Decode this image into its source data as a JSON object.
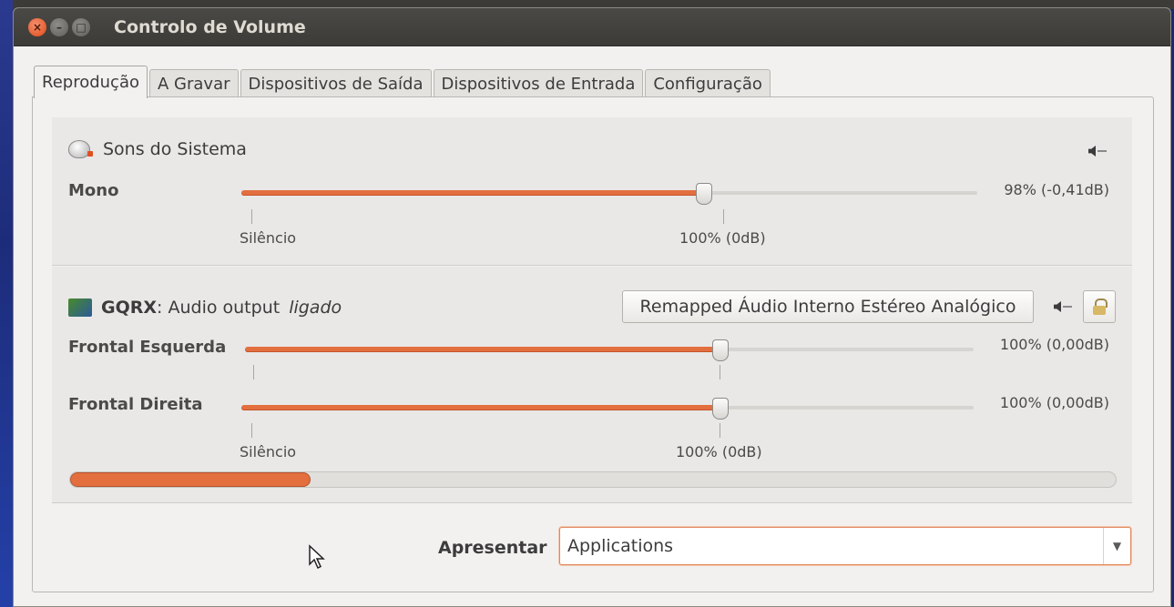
{
  "window": {
    "title": "Controlo de Volume"
  },
  "window_controls": {
    "close": "×",
    "minimize": "–",
    "maximize": "□"
  },
  "tabs": [
    {
      "label": "Reprodução",
      "active": true
    },
    {
      "label": "A Gravar",
      "active": false
    },
    {
      "label": "Dispositivos de Saída",
      "active": false
    },
    {
      "label": "Dispositivos de Entrada",
      "active": false
    },
    {
      "label": "Configuração",
      "active": false
    }
  ],
  "streams": [
    {
      "app_name": "Sons do Sistema",
      "icon": "system-sounds-icon",
      "channels": [
        {
          "label": "Mono",
          "value_text": "98% (-0,41dB)",
          "level": 0.98
        }
      ],
      "scale_marks": {
        "min": "Silêncio",
        "norm": "100% (0dB)"
      }
    },
    {
      "app_name": "GQRX",
      "app_desc": ": Audio output",
      "state": "ligado",
      "icon": "gqrx-icon",
      "device": "Remapped Áudio Interno Estéreo Analógico",
      "channels": [
        {
          "label": "Frontal Esquerda",
          "value_text": "100% (0,00dB)",
          "level": 1.0
        },
        {
          "label": "Frontal Direita",
          "value_text": "100% (0,00dB)",
          "level": 1.0
        }
      ],
      "scale_marks": {
        "min": "Silêncio",
        "norm": "100% (0dB)"
      },
      "peak_level": 0.23
    }
  ],
  "footer": {
    "label": "Apresentar",
    "combo_value": "Applications"
  },
  "colors": {
    "accent": "#e36f3f",
    "titlebar": "#3c3b37",
    "window_bg": "#f2f1f0"
  }
}
